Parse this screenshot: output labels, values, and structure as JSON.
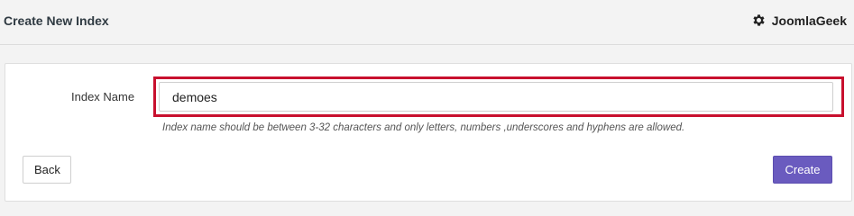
{
  "header": {
    "title": "Create New Index",
    "brand_icon": "gear-icon",
    "brand_name": "JoomlaGeek"
  },
  "form": {
    "index_name_label": "Index Name",
    "index_name_value": "demoes",
    "help_text": "Index name should be between 3-32 characters and only letters, numbers ,underscores and hyphens are allowed."
  },
  "actions": {
    "back_label": "Back",
    "create_label": "Create"
  },
  "colors": {
    "highlight": "#c8102e",
    "primary_button": "#6a5bbf"
  }
}
